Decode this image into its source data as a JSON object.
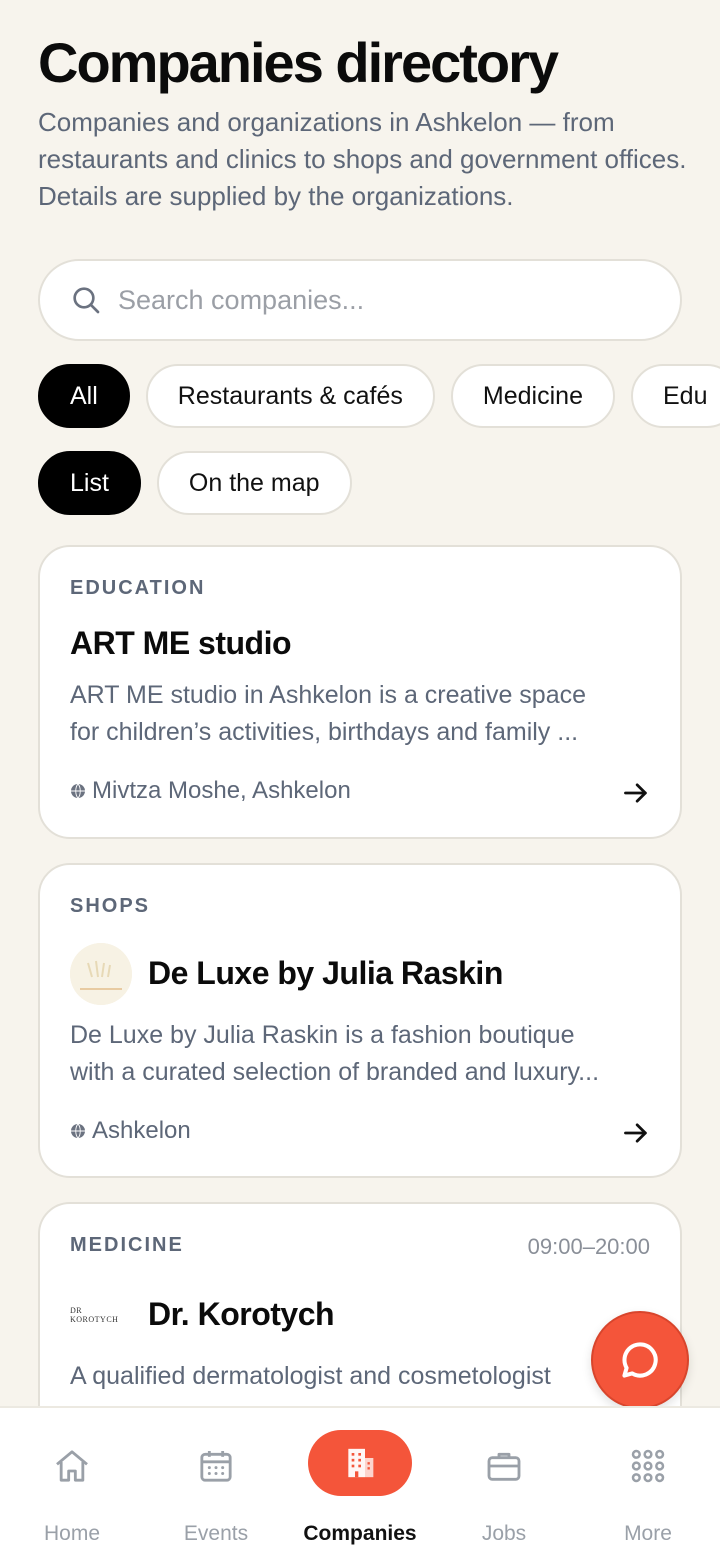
{
  "header": {
    "title": "Companies directory",
    "subtitle": "Companies and organizations in Ashkelon — from restaurants and clinics to shops and government offices. Details are supplied by the organizations."
  },
  "search": {
    "placeholder": "Search companies..."
  },
  "filters": [
    {
      "label": "All",
      "active": true
    },
    {
      "label": "Restaurants & cafés",
      "active": false
    },
    {
      "label": "Medicine",
      "active": false
    },
    {
      "label": "Edu",
      "active": false
    }
  ],
  "views": [
    {
      "label": "List",
      "active": true
    },
    {
      "label": "On the map",
      "active": false
    }
  ],
  "companies": [
    {
      "category": "EDUCATION",
      "name": "ART ME studio",
      "desc1": "ART ME studio in Ashkelon is a creative space",
      "desc2": "for children’s activities, birthdays and family ...",
      "location": "Mivtza Moshe, Ashkelon"
    },
    {
      "category": "SHOPS",
      "name": "De Luxe by Julia Raskin",
      "desc1": "De Luxe by Julia Raskin is a fashion boutique",
      "desc2": "with a curated selection of branded and luxury...",
      "location": "Ashkelon"
    },
    {
      "category": "MEDICINE",
      "hours": "09:00–20:00",
      "name": "Dr. Korotych",
      "desc1": "A qualified dermatologist and cosmetologist",
      "logo_text": "DR KOROTYCH"
    }
  ],
  "nav": [
    {
      "label": "Home",
      "icon": "home-icon"
    },
    {
      "label": "Events",
      "icon": "calendar-icon"
    },
    {
      "label": "Companies",
      "icon": "building-icon",
      "active": true
    },
    {
      "label": "Jobs",
      "icon": "briefcase-icon"
    },
    {
      "label": "More",
      "icon": "grid-icon"
    }
  ],
  "colors": {
    "accent": "#f4553a",
    "background": "#f7f4ed"
  }
}
